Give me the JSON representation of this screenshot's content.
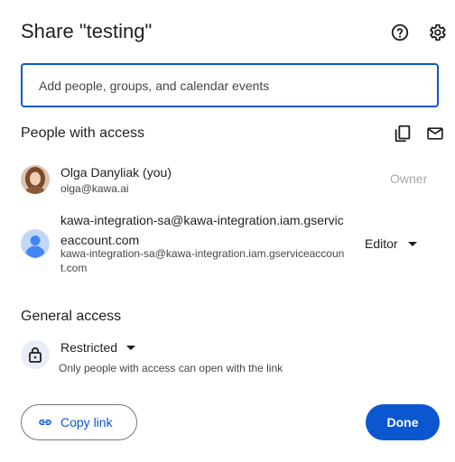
{
  "dialog": {
    "title": "Share \"testing\"",
    "icons": {
      "help": "help-circle-icon",
      "settings": "gear-icon"
    },
    "add_input": {
      "placeholder": "Add people, groups, and calendar events",
      "value": ""
    },
    "people_section": {
      "title": "People with access",
      "icons": {
        "copy": "copy-icon",
        "email": "mail-icon"
      },
      "people": [
        {
          "name": "Olga Danyliak (you)",
          "email": "olga@kawa.ai",
          "role": "Owner",
          "avatar": "photo"
        },
        {
          "name": "kawa-integration-sa@kawa-integration.iam.gserviceaccount.com",
          "email": "kawa-integration-sa@kawa-integration.iam.gserviceaccount.com",
          "role": "Editor",
          "avatar": "default-person-icon"
        }
      ]
    },
    "general_section": {
      "title": "General access",
      "icon": "lock-icon",
      "access_level": "Restricted",
      "description": "Only people with access can open with the link"
    },
    "footer": {
      "copy_link_label": "Copy link",
      "copy_link_icon": "link-icon",
      "done_label": "Done"
    },
    "colors": {
      "accent": "#0b57d0",
      "text": "#1f1f1f",
      "muted": "#444746",
      "owner_text": "#a8a8a8",
      "lock_bg": "#e9eef6"
    }
  }
}
